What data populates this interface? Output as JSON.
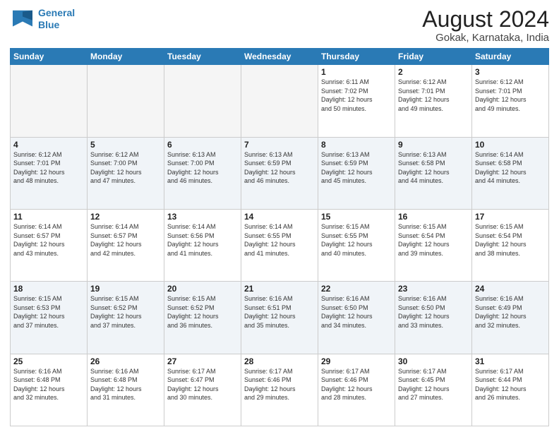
{
  "header": {
    "logo_line1": "General",
    "logo_line2": "Blue",
    "title": "August 2024",
    "subtitle": "Gokak, Karnataka, India"
  },
  "days_of_week": [
    "Sunday",
    "Monday",
    "Tuesday",
    "Wednesday",
    "Thursday",
    "Friday",
    "Saturday"
  ],
  "weeks": [
    [
      {
        "day": "",
        "info": ""
      },
      {
        "day": "",
        "info": ""
      },
      {
        "day": "",
        "info": ""
      },
      {
        "day": "",
        "info": ""
      },
      {
        "day": "1",
        "info": "Sunrise: 6:11 AM\nSunset: 7:02 PM\nDaylight: 12 hours\nand 50 minutes."
      },
      {
        "day": "2",
        "info": "Sunrise: 6:12 AM\nSunset: 7:01 PM\nDaylight: 12 hours\nand 49 minutes."
      },
      {
        "day": "3",
        "info": "Sunrise: 6:12 AM\nSunset: 7:01 PM\nDaylight: 12 hours\nand 49 minutes."
      }
    ],
    [
      {
        "day": "4",
        "info": "Sunrise: 6:12 AM\nSunset: 7:01 PM\nDaylight: 12 hours\nand 48 minutes."
      },
      {
        "day": "5",
        "info": "Sunrise: 6:12 AM\nSunset: 7:00 PM\nDaylight: 12 hours\nand 47 minutes."
      },
      {
        "day": "6",
        "info": "Sunrise: 6:13 AM\nSunset: 7:00 PM\nDaylight: 12 hours\nand 46 minutes."
      },
      {
        "day": "7",
        "info": "Sunrise: 6:13 AM\nSunset: 6:59 PM\nDaylight: 12 hours\nand 46 minutes."
      },
      {
        "day": "8",
        "info": "Sunrise: 6:13 AM\nSunset: 6:59 PM\nDaylight: 12 hours\nand 45 minutes."
      },
      {
        "day": "9",
        "info": "Sunrise: 6:13 AM\nSunset: 6:58 PM\nDaylight: 12 hours\nand 44 minutes."
      },
      {
        "day": "10",
        "info": "Sunrise: 6:14 AM\nSunset: 6:58 PM\nDaylight: 12 hours\nand 44 minutes."
      }
    ],
    [
      {
        "day": "11",
        "info": "Sunrise: 6:14 AM\nSunset: 6:57 PM\nDaylight: 12 hours\nand 43 minutes."
      },
      {
        "day": "12",
        "info": "Sunrise: 6:14 AM\nSunset: 6:57 PM\nDaylight: 12 hours\nand 42 minutes."
      },
      {
        "day": "13",
        "info": "Sunrise: 6:14 AM\nSunset: 6:56 PM\nDaylight: 12 hours\nand 41 minutes."
      },
      {
        "day": "14",
        "info": "Sunrise: 6:14 AM\nSunset: 6:55 PM\nDaylight: 12 hours\nand 41 minutes."
      },
      {
        "day": "15",
        "info": "Sunrise: 6:15 AM\nSunset: 6:55 PM\nDaylight: 12 hours\nand 40 minutes."
      },
      {
        "day": "16",
        "info": "Sunrise: 6:15 AM\nSunset: 6:54 PM\nDaylight: 12 hours\nand 39 minutes."
      },
      {
        "day": "17",
        "info": "Sunrise: 6:15 AM\nSunset: 6:54 PM\nDaylight: 12 hours\nand 38 minutes."
      }
    ],
    [
      {
        "day": "18",
        "info": "Sunrise: 6:15 AM\nSunset: 6:53 PM\nDaylight: 12 hours\nand 37 minutes."
      },
      {
        "day": "19",
        "info": "Sunrise: 6:15 AM\nSunset: 6:52 PM\nDaylight: 12 hours\nand 37 minutes."
      },
      {
        "day": "20",
        "info": "Sunrise: 6:15 AM\nSunset: 6:52 PM\nDaylight: 12 hours\nand 36 minutes."
      },
      {
        "day": "21",
        "info": "Sunrise: 6:16 AM\nSunset: 6:51 PM\nDaylight: 12 hours\nand 35 minutes."
      },
      {
        "day": "22",
        "info": "Sunrise: 6:16 AM\nSunset: 6:50 PM\nDaylight: 12 hours\nand 34 minutes."
      },
      {
        "day": "23",
        "info": "Sunrise: 6:16 AM\nSunset: 6:50 PM\nDaylight: 12 hours\nand 33 minutes."
      },
      {
        "day": "24",
        "info": "Sunrise: 6:16 AM\nSunset: 6:49 PM\nDaylight: 12 hours\nand 32 minutes."
      }
    ],
    [
      {
        "day": "25",
        "info": "Sunrise: 6:16 AM\nSunset: 6:48 PM\nDaylight: 12 hours\nand 32 minutes."
      },
      {
        "day": "26",
        "info": "Sunrise: 6:16 AM\nSunset: 6:48 PM\nDaylight: 12 hours\nand 31 minutes."
      },
      {
        "day": "27",
        "info": "Sunrise: 6:17 AM\nSunset: 6:47 PM\nDaylight: 12 hours\nand 30 minutes."
      },
      {
        "day": "28",
        "info": "Sunrise: 6:17 AM\nSunset: 6:46 PM\nDaylight: 12 hours\nand 29 minutes."
      },
      {
        "day": "29",
        "info": "Sunrise: 6:17 AM\nSunset: 6:46 PM\nDaylight: 12 hours\nand 28 minutes."
      },
      {
        "day": "30",
        "info": "Sunrise: 6:17 AM\nSunset: 6:45 PM\nDaylight: 12 hours\nand 27 minutes."
      },
      {
        "day": "31",
        "info": "Sunrise: 6:17 AM\nSunset: 6:44 PM\nDaylight: 12 hours\nand 26 minutes."
      }
    ]
  ]
}
